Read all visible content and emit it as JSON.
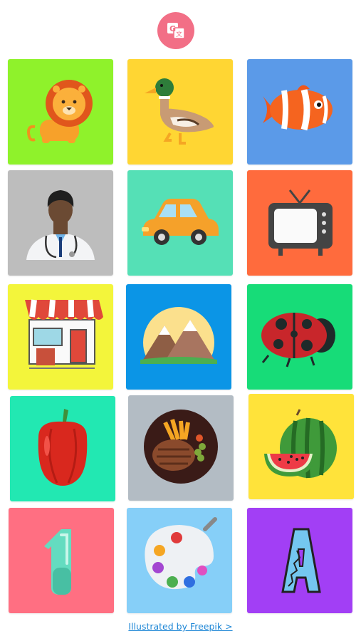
{
  "app": {
    "logo_icon": "translate-icon"
  },
  "tiles": [
    {
      "name": "lion",
      "color": "#8ff22b"
    },
    {
      "name": "duck",
      "color": "#ffd633"
    },
    {
      "name": "fish",
      "color": "#5b9ae8"
    },
    {
      "name": "doctor",
      "color": "#bdbdbd"
    },
    {
      "name": "car",
      "color": "#55e0b6"
    },
    {
      "name": "tv",
      "color": "#ff6b3d"
    },
    {
      "name": "shop",
      "color": "#f3f53b"
    },
    {
      "name": "mountains",
      "color": "#0b95e6"
    },
    {
      "name": "ladybug",
      "color": "#17dc78"
    },
    {
      "name": "pepper",
      "color": "#22e8b2"
    },
    {
      "name": "steak",
      "color": "#b3bcc4"
    },
    {
      "name": "watermelon",
      "color": "#ffe33a"
    },
    {
      "name": "number-one",
      "color": "#ff6f82"
    },
    {
      "name": "palette",
      "color": "#86cff8"
    },
    {
      "name": "letter-a",
      "color": "#a23ff5"
    }
  ],
  "footer": {
    "credit_link": "Illustrated by Freepik >"
  }
}
